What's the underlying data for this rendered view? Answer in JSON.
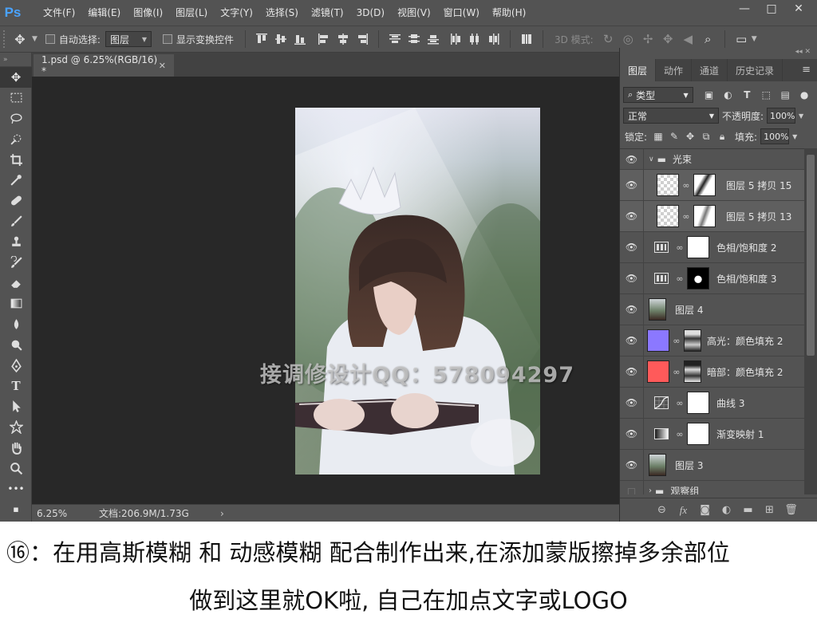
{
  "app": {
    "logo": "Ps"
  },
  "menu": [
    "文件(F)",
    "编辑(E)",
    "图像(I)",
    "图层(L)",
    "文字(Y)",
    "选择(S)",
    "滤镜(T)",
    "3D(D)",
    "视图(V)",
    "窗口(W)",
    "帮助(H)"
  ],
  "window_controls": {
    "minimize": "—",
    "maximize": "□",
    "close": "✕"
  },
  "options": {
    "auto_select_label": "自动选择:",
    "auto_select_value": "图层",
    "show_transform_label": "显示变换控件",
    "mode_3d_label": "3D 模式:"
  },
  "document": {
    "tab_title": "1.psd @ 6.25%(RGB/16) *",
    "zoom": "6.25%",
    "doc_info": "文档:206.9M/1.73G",
    "watermark": "接调修设计QQ：578094297"
  },
  "layers_panel": {
    "tabs": [
      "图层",
      "动作",
      "通道",
      "历史记录"
    ],
    "filter_kind": "类型",
    "blend_mode": "正常",
    "opacity_label": "不透明度:",
    "opacity_value": "100%",
    "lock_label": "锁定:",
    "fill_label": "填充:",
    "fill_value": "100%",
    "layers": [
      {
        "name": "光束",
        "kind": "group"
      },
      {
        "name": "图层 5 拷贝 15",
        "kind": "pixel-mask"
      },
      {
        "name": "图层 5 拷贝 13",
        "kind": "pixel-mask"
      },
      {
        "name": "色相/饱和度 2",
        "kind": "adjust-hue"
      },
      {
        "name": "色相/饱和度 3",
        "kind": "adjust-hue"
      },
      {
        "name": "图层 4",
        "kind": "photo"
      },
      {
        "name": "高光：颜色填充 2",
        "kind": "fill",
        "color": "#8b78ff"
      },
      {
        "name": "暗部：颜色填充 2",
        "kind": "fill",
        "color": "#ff5a5a"
      },
      {
        "name": "曲线 3",
        "kind": "adjust-curves"
      },
      {
        "name": "渐变映射 1",
        "kind": "adjust-gradient"
      },
      {
        "name": "图层 3",
        "kind": "photo"
      },
      {
        "name": "观察组",
        "kind": "group-collapsed"
      }
    ]
  },
  "caption": {
    "line1": "⑯：在用高斯模糊 和 动感模糊 配合制作出来,在添加蒙版擦掉多余部位",
    "line2": "做到这里就OK啦, 自己在加点文字或LOGO"
  }
}
